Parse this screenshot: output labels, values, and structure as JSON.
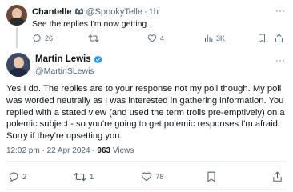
{
  "reply": {
    "name": "Chantelle",
    "handle": "@SpookyTelle",
    "separator": "·",
    "time": "1h",
    "text": "See the replies I'm now getting...",
    "more": "···",
    "replies": "26",
    "retweets": "",
    "likes": "4",
    "views": "3K"
  },
  "tweet": {
    "name": "Martin Lewis",
    "handle": "@MartinSLewis",
    "text_lines": [
      "Yes I do. The replies are to your response not my poll though.  My poll",
      "was worded neutrally as I was interested in gathering information. You",
      "replied with a stated view (and used the term trolls pre-emptively) on a",
      "polemic subject -  so you're going to get polemic responses I'm afraid.",
      "Sorry if they're upsetting you."
    ],
    "time": "12:02 pm · 22 Apr 2024 · ",
    "views_count": "963",
    "views_label": " Views",
    "more": "···",
    "replies": "2",
    "retweets": "1",
    "likes": "78"
  },
  "colors": {
    "text": "#0f1419",
    "secondary": "#536471",
    "verified": "#1d9bf0",
    "divider": "#eff3f4"
  },
  "icons": [
    "bird-owl-icon",
    "verified-badge-icon",
    "reply-icon",
    "retweet-icon",
    "like-icon",
    "views-icon",
    "bookmark-icon",
    "share-icon",
    "more-icon"
  ]
}
